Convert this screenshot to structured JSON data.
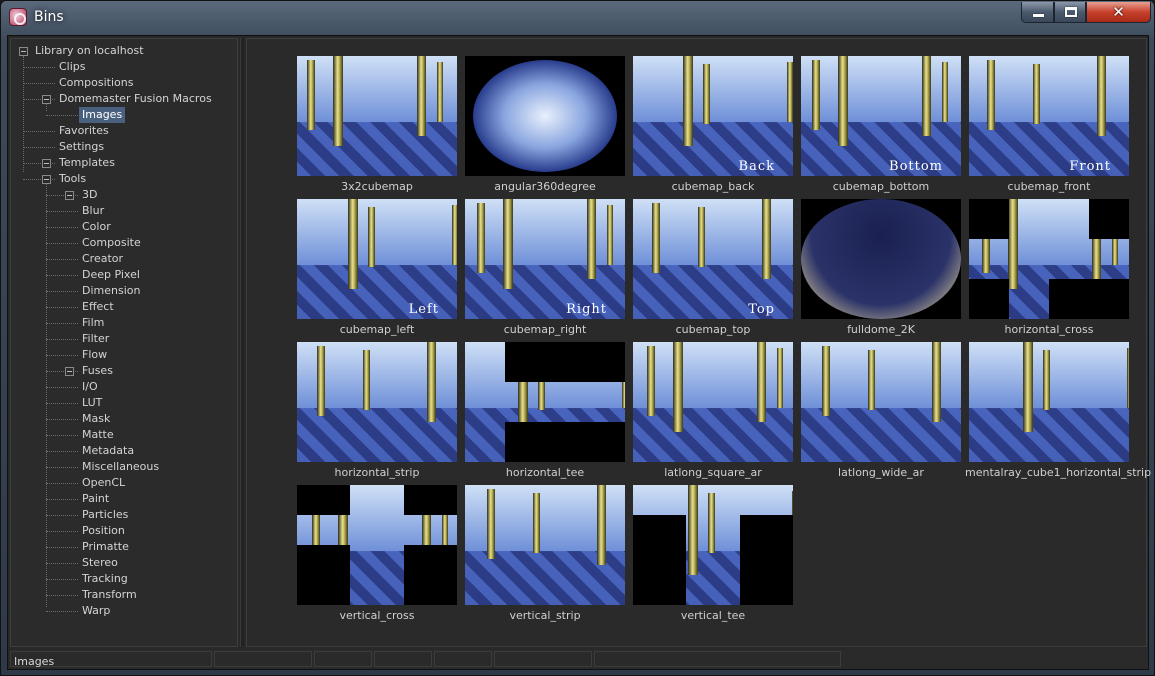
{
  "window": {
    "title": "Bins",
    "close_glyph": "✕"
  },
  "tree": {
    "root": "Library on localhost",
    "items": [
      "Clips",
      "Compositions",
      "Domemaster Fusion Macros",
      "Images",
      "Favorites",
      "Settings",
      "Templates",
      "Tools",
      "3D",
      "Blur",
      "Color",
      "Composite",
      "Creator",
      "Deep Pixel",
      "Dimension",
      "Effect",
      "Film",
      "Filter",
      "Flow",
      "Fuses",
      "I/O",
      "LUT",
      "Mask",
      "Matte",
      "Metadata",
      "Miscellaneous",
      "OpenCL",
      "Paint",
      "Particles",
      "Position",
      "Primatte",
      "Stereo",
      "Tracking",
      "Transform",
      "Warp"
    ],
    "selected": "Images"
  },
  "thumbnails": [
    {
      "name": "3x2cubemap"
    },
    {
      "name": "angular360degree"
    },
    {
      "name": "cubemap_back",
      "face_label": "Back"
    },
    {
      "name": "cubemap_bottom",
      "face_label": "Bottom"
    },
    {
      "name": "cubemap_front",
      "face_label": "Front"
    },
    {
      "name": "cubemap_left",
      "face_label": "Left"
    },
    {
      "name": "cubemap_right",
      "face_label": "Right"
    },
    {
      "name": "cubemap_top",
      "face_label": "Top"
    },
    {
      "name": "fulldome_2K"
    },
    {
      "name": "horizontal_cross"
    },
    {
      "name": "horizontal_strip"
    },
    {
      "name": "horizontal_tee"
    },
    {
      "name": "latlong_square_ar"
    },
    {
      "name": "latlong_wide_ar"
    },
    {
      "name": "mentalray_cube1_horizontal_strip"
    },
    {
      "name": "vertical_cross"
    },
    {
      "name": "vertical_strip"
    },
    {
      "name": "vertical_tee"
    }
  ],
  "status": {
    "text": "Images"
  },
  "colors": {
    "selection": "#49617e",
    "background": "#2a2a2a",
    "close_button": "#c8412c"
  },
  "icons": {
    "app": "fusion-app-icon",
    "minimize": "minimize-icon",
    "maximize": "maximize-icon",
    "close": "close-icon",
    "expander": "tree-collapse-icon"
  }
}
